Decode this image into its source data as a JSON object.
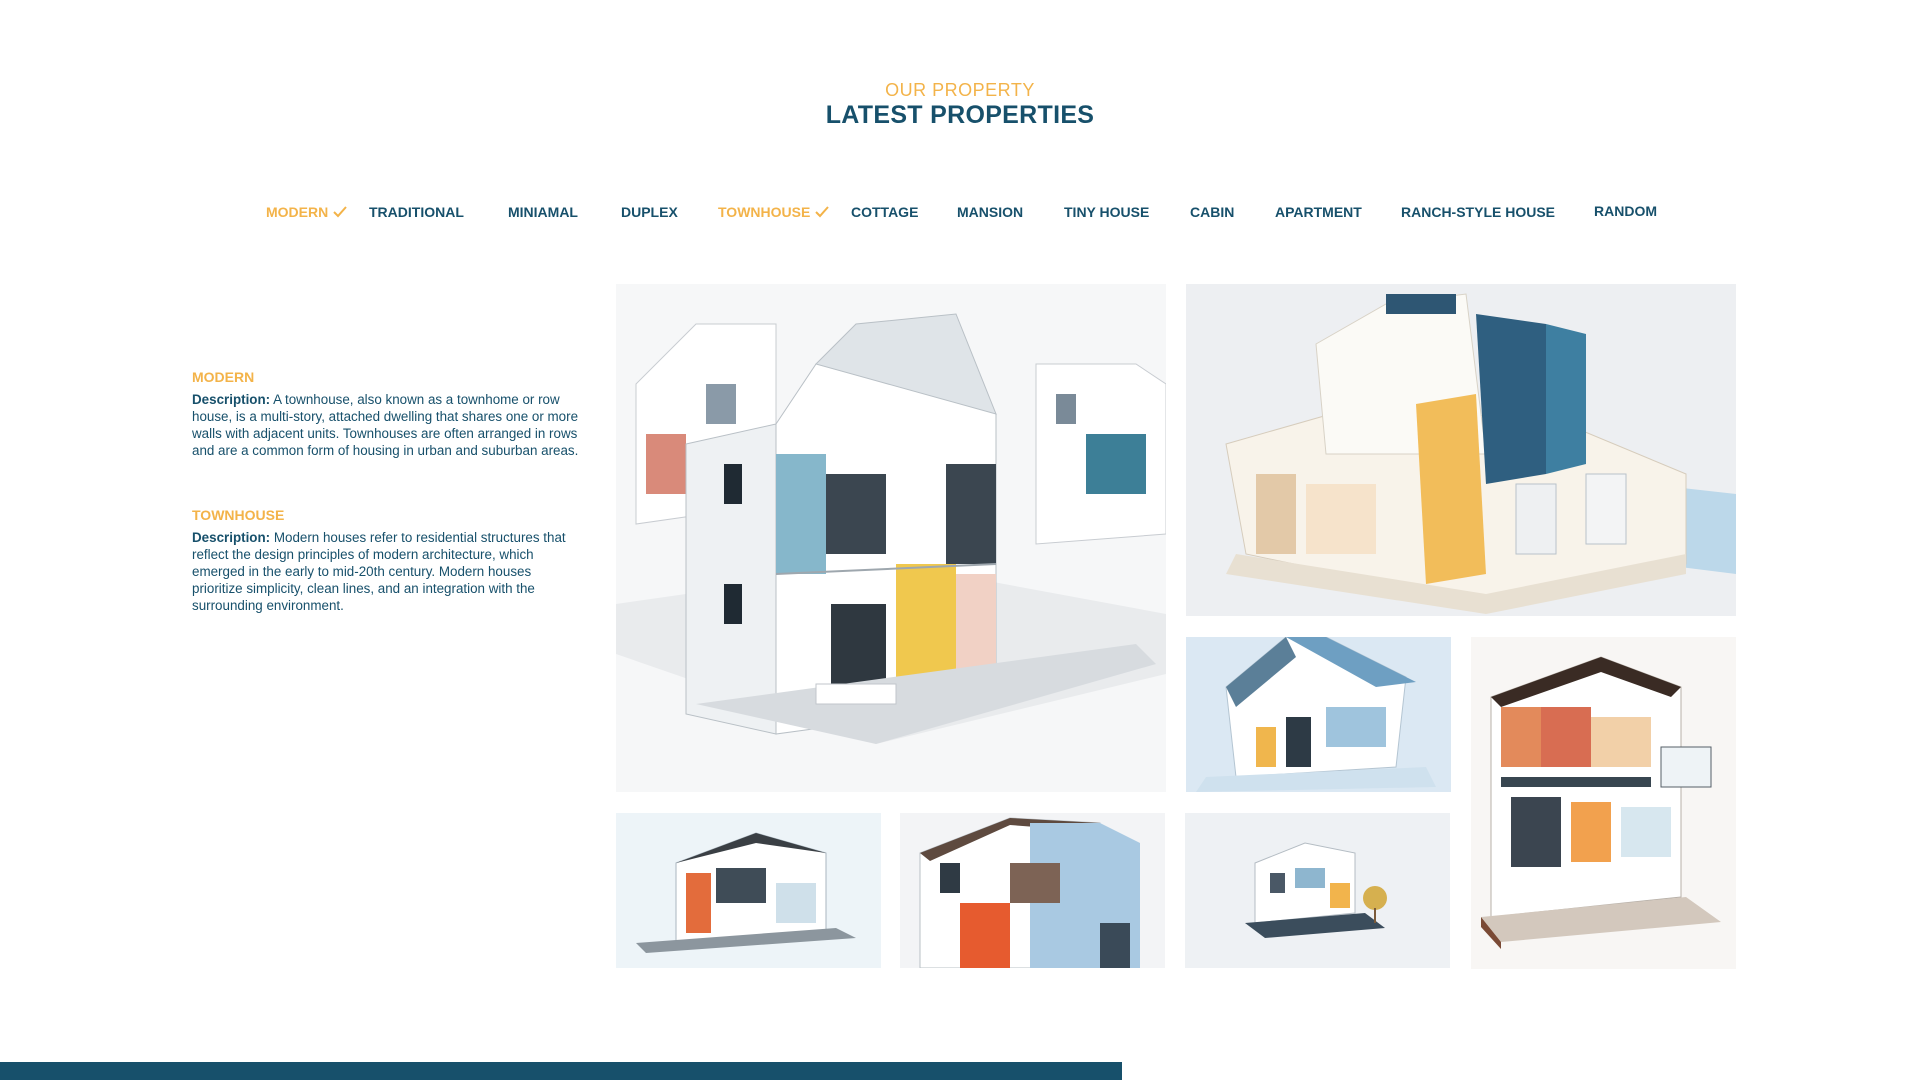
{
  "header": {
    "eyebrow": "OUR PROPERTY",
    "title": "LATEST PROPERTIES"
  },
  "filters": [
    {
      "label": "MODERN",
      "active": true
    },
    {
      "label": "TRADITIONAL",
      "active": false
    },
    {
      "label": "MINIAMAL",
      "active": false
    },
    {
      "label": "DUPLEX",
      "active": false
    },
    {
      "label": "TOWNHOUSE",
      "active": true
    },
    {
      "label": "COTTAGE",
      "active": false
    },
    {
      "label": "MANSION",
      "active": false
    },
    {
      "label": "TINY HOUSE",
      "active": false
    },
    {
      "label": "CABIN",
      "active": false
    },
    {
      "label": "APARTMENT",
      "active": false
    },
    {
      "label": "RANCH-STYLE HOUSE",
      "active": false
    },
    {
      "label": "RANDOM",
      "active": false
    }
  ],
  "descriptions": [
    {
      "title": "MODERN",
      "label": "Description:",
      "text": " A townhouse, also known as a townhome or row house, is a multi-story, attached dwelling that shares one or more walls with adjacent units. Townhouses are often arranged in rows and are a common form of housing in urban and suburban areas."
    },
    {
      "title": "TOWNHOUSE",
      "label": "Description:",
      "text": " Modern houses refer to residential structures that reflect the design principles of modern architecture, which emerged in the early to mid-20th century. Modern houses prioritize simplicity, clean lines, and an integration with the surrounding environment."
    }
  ],
  "colors": {
    "primary": "#17506b",
    "accent": "#f3b349"
  },
  "icons": {
    "check": "check-icon"
  }
}
